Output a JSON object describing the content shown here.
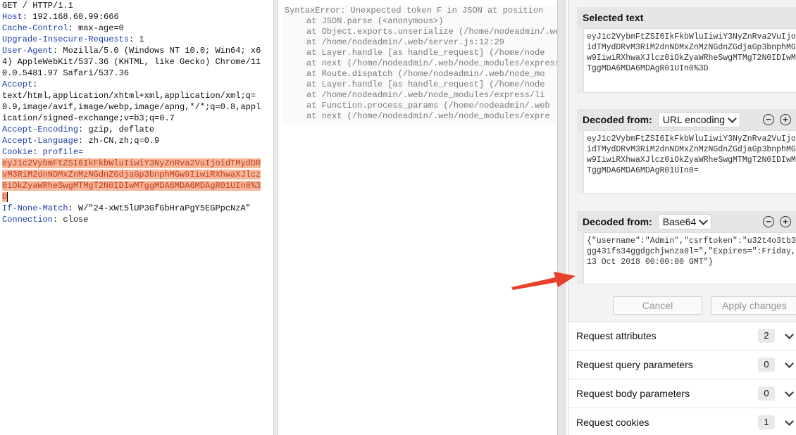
{
  "request": {
    "request_line": "GET / HTTP/1.1",
    "headers": [
      {
        "name": "Host",
        "value": "192.168.60.99:666"
      },
      {
        "name": "Cache-Control",
        "value": "max-age=0"
      },
      {
        "name": "Upgrade-Insecure-Requests",
        "value": "1"
      },
      {
        "name": "User-Agent",
        "value": "Mozilla/5.0 (Windows NT 10.0; Win64; x64) AppleWebKit/537.36 (KHTML, like Gecko) Chrome/110.0.5481.97 Safari/537.36"
      },
      {
        "name": "Accept",
        "value": "text/html,application/xhtml+xml,application/xml;q=0.9,image/avif,image/webp,image/apng,*/*;q=0.8,application/signed-exchange;v=b3;q=0.7"
      },
      {
        "name": "Accept-Encoding",
        "value": "gzip, deflate"
      },
      {
        "name": "Accept-Language",
        "value": "zh-CN,zh;q=0.9"
      },
      {
        "name": "Cookie",
        "value": "profile="
      },
      {
        "name": "If-None-Match",
        "value": "W/\"24-xWt5lUP3GfGbHraPgY5EGPpcNzA\""
      },
      {
        "name": "Connection",
        "value": "close"
      }
    ],
    "cookie_value": "eyJ1c2VybmFtZSI6IkFkbWluIiwiY3NyZnRva2VuIjoidTMydDRvM3RiM2dnNDMxZnMzNGdnZGdjaGp3bnphMGw9IiwiRXhwaXJlcz0iOkZyaWRheSwgMTMgT2N0IDIwMTggMDA6MDA6MDAgR01UIn0%3D"
  },
  "response": {
    "lines": [
      "SyntaxError: Unexpected token F in JSON at position",
      "at JSON.parse (<anonymous>)",
      "at Object.exports.unserialize (/home/nodeadmin/.web/",
      "at /home/nodeadmin/.web/server.js:12:29",
      "at Layer.handle [as handle_request] (/home/node",
      "at next (/home/nodeadmin/.web/node_modules/express",
      "at Route.dispatch (/home/nodeadmin/.web/node_mo",
      "at Layer.handle [as handle_request] (/home/node",
      "at /home/nodeadmin/.web/node_modules/express/li",
      "at Function.process_params (/home/nodeadmin/.web",
      "at next (/home/nodeadmin/.web/node_modules/expre"
    ]
  },
  "inspector": {
    "selected_text": {
      "title": "Selected text",
      "value": "eyJ1c2VybmFtZSI6IkFkbWluIiwiY3NyZnRva2VuIjoidTMydDRvM3RiM2dnNDMxZnMzNGdnZGdjaGp3bnphMGw9IiwiRXhwaXJlcz0iOkZyaWRheSwgMTMgT2N0IDIwMTggMDA6MDA6MDAgR01UIn0%3D"
    },
    "decoded_1": {
      "title": "Decoded from:",
      "method": "URL encoding",
      "value": "eyJ1c2VybmFtZSI6IkFkbWluIiwiY3NyZnRva2VuIjoidTMydDRvM3RiM2dnNDMxZnMzNGdnZGdjaGp3bnphMGw9IiwiRXhwaXJlcz0iOkZyaWRheSwgMTMgT2N0IDIwMTggMDA6MDA6MDAgR01UIn0="
    },
    "decoded_2": {
      "title": "Decoded from:",
      "method": "Base64",
      "value": "{\"username\":\"Admin\",\"csrftoken\":\"u32t4o3tb3gg431fs34ggdgchjwnza0l=\",\"Expires=\":Friday, 13 Oct 2018 00:00:00 GMT\"}"
    },
    "cancel_label": "Cancel",
    "apply_label": "Apply changes",
    "accordions": [
      {
        "label": "Request attributes",
        "count": "2"
      },
      {
        "label": "Request query parameters",
        "count": "0"
      },
      {
        "label": "Request body parameters",
        "count": "0"
      },
      {
        "label": "Request cookies",
        "count": "1"
      }
    ],
    "minus_symbol": "−",
    "plus_symbol": "+"
  },
  "colors": {
    "header_name": "#1f3ea8",
    "highlight_bg": "#f6b79a",
    "highlight_fg": "#c23a1e",
    "arrow": "#e8412b"
  }
}
